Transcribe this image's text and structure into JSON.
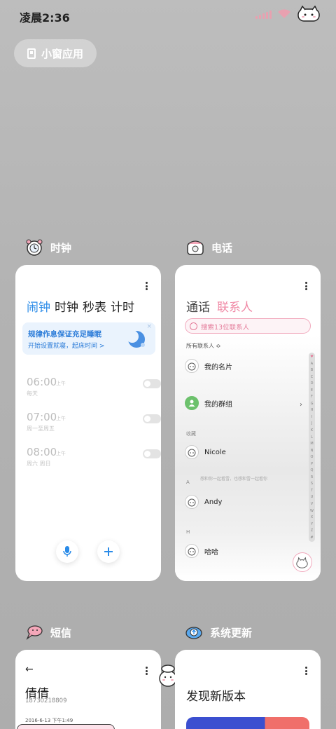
{
  "status_bar": {
    "time": "凌晨2:36"
  },
  "small_window": {
    "label": "小窗应用"
  },
  "clock": {
    "app_name": "时钟",
    "tabs": [
      "闹钟",
      "时钟",
      "秒表",
      "计时"
    ],
    "banner_title": "规律作息保证充足睡眠",
    "banner_sub": "开始设置就寝，起床时间 >",
    "banner_close": "×",
    "alarms": [
      {
        "time": "06:00",
        "ampm": "上午",
        "days": "每天",
        "enabled": false
      },
      {
        "time": "07:00",
        "ampm": "上午",
        "days": "周一至周五",
        "enabled": false
      },
      {
        "time": "08:00",
        "ampm": "上午",
        "days": "周六 周日",
        "enabled": false
      }
    ]
  },
  "phone": {
    "app_name": "电话",
    "tabs": [
      "通话",
      "联系人"
    ],
    "search_placeholder": "搜索13位联系人",
    "all_contacts": "所有联系人 ≎",
    "my_card": "我的名片",
    "my_groups": "我的群组",
    "section_favorites": "收藏",
    "contacts": [
      {
        "section": "",
        "name": "Nicole"
      },
      {
        "section": "A",
        "name": "Andy"
      },
      {
        "section": "H",
        "name": "哈哈"
      }
    ],
    "alphabet": [
      "♥",
      "A",
      "B",
      "C",
      "D",
      "E",
      "F",
      "G",
      "H",
      "I",
      "J",
      "K",
      "L",
      "M",
      "N",
      "O",
      "P",
      "Q",
      "R",
      "S",
      "T",
      "U",
      "V",
      "W",
      "X",
      "Y",
      "Z",
      "#"
    ],
    "watermark": "想和你一起看雪，也想和雪一起看你",
    "arrow": "›"
  },
  "sms": {
    "app_name": "短信",
    "back": "←",
    "contact_name": "倩倩",
    "phone_number": "18730218809",
    "date": "2016-6-13 下午1:49"
  },
  "update": {
    "app_name": "系统更新",
    "title": "发现新版本"
  },
  "colors": {
    "accent_blue": "#2a8be8",
    "accent_pink": "#f08aa6",
    "update_blue": "#3b4fd0",
    "update_red": "#f06f6a"
  }
}
